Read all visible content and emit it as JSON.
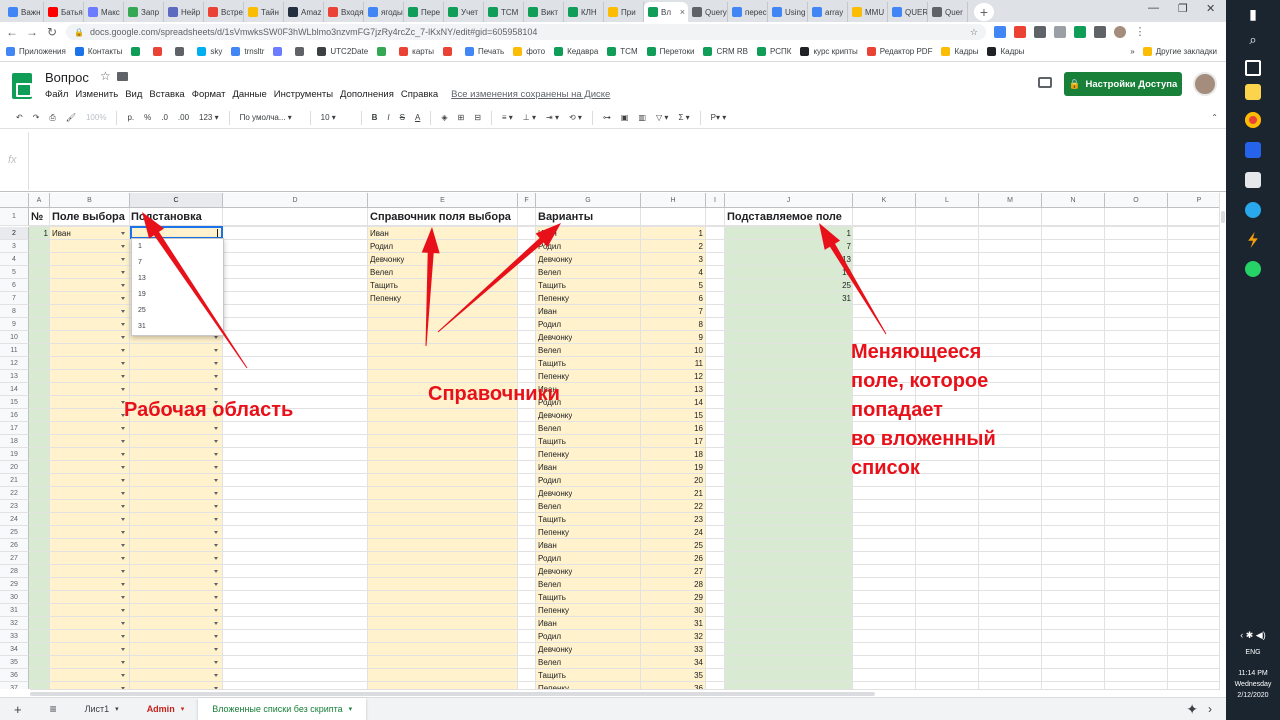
{
  "browser": {
    "tabs": [
      {
        "label": "Важн",
        "color": "#4285f4"
      },
      {
        "label": "Батья",
        "color": "#ff0000"
      },
      {
        "label": "Макс",
        "color": "#6b7cff"
      },
      {
        "label": "Запр",
        "color": "#34a853"
      },
      {
        "label": "Нейр",
        "color": "#5c6bc0"
      },
      {
        "label": "Встре",
        "color": "#ea4335"
      },
      {
        "label": "Тайн",
        "color": "#fbbc04"
      },
      {
        "label": "Amaz",
        "color": "#232f3e"
      },
      {
        "label": "Входя",
        "color": "#ea4335"
      },
      {
        "label": "ягоды",
        "color": "#4285f4"
      },
      {
        "label": "Пере",
        "color": "#0f9d58"
      },
      {
        "label": "Учет",
        "color": "#0f9d58"
      },
      {
        "label": "TCM",
        "color": "#0f9d58"
      },
      {
        "label": "Викт",
        "color": "#0f9d58"
      },
      {
        "label": "КЛН",
        "color": "#0f9d58"
      },
      {
        "label": "При",
        "color": "#fbbc04"
      },
      {
        "label": "Вл",
        "color": "#0f9d58",
        "active": true
      },
      {
        "label": "Query",
        "color": "#5f6368"
      },
      {
        "label": "перес",
        "color": "#4285f4"
      },
      {
        "label": "Using",
        "color": "#4285f4"
      },
      {
        "label": "array",
        "color": "#4285f4"
      },
      {
        "label": "MMU",
        "color": "#fbbc04"
      },
      {
        "label": "QUER",
        "color": "#4285f4"
      },
      {
        "label": "Quer",
        "color": "#5f6368"
      }
    ],
    "new_tab": "+",
    "win_min": "—",
    "win_max": "❐",
    "win_close": "✕",
    "url": "docs.google.com/spreadsheets/d/1sVmwksSW0F3hWLblmo3nzvmFG7jzRy4rcZc_7-lKxNY/edit#gid=605958104",
    "bookmarks": [
      {
        "label": "Приложения",
        "color": "#4285f4"
      },
      {
        "label": "Контакты",
        "color": "#1a73e8"
      },
      {
        "label": "",
        "color": "#0f9d58"
      },
      {
        "label": "",
        "color": "#ea4335"
      },
      {
        "label": "",
        "color": "#5f6368"
      },
      {
        "label": "sky",
        "color": "#00aff0"
      },
      {
        "label": "trnsltr",
        "color": "#4285f4"
      },
      {
        "label": "",
        "color": "#6b7cff"
      },
      {
        "label": "",
        "color": "#5f6368"
      },
      {
        "label": "UTC2Date",
        "color": "#3c4043"
      },
      {
        "label": "",
        "color": "#34a853"
      },
      {
        "label": "карты",
        "color": "#ea4335"
      },
      {
        "label": "",
        "color": "#ea4335"
      },
      {
        "label": "Печать",
        "color": "#4285f4"
      },
      {
        "label": "фото",
        "color": "#fbbc04"
      },
      {
        "label": "Кедавра",
        "color": "#0f9d58"
      },
      {
        "label": "TCM",
        "color": "#0f9d58"
      },
      {
        "label": "Перетоки",
        "color": "#0f9d58"
      },
      {
        "label": "CRM RB",
        "color": "#0f9d58"
      },
      {
        "label": "РСПК",
        "color": "#0f9d58"
      },
      {
        "label": "курс крипты",
        "color": "#202124"
      },
      {
        "label": "Редактор PDF",
        "color": "#ea4335"
      },
      {
        "label": "Кадры",
        "color": "#fbbc04"
      },
      {
        "label": "Кадры",
        "color": "#202124"
      }
    ],
    "bookmarks_more": "»",
    "other_bookmarks": "Другие закладки"
  },
  "sheets": {
    "title": "Вопрос",
    "menu": [
      "Файл",
      "Изменить",
      "Вид",
      "Вставка",
      "Формат",
      "Данные",
      "Инструменты",
      "Дополнения",
      "Справка"
    ],
    "saved_status": "Все изменения сохранены на Диске",
    "share_label": "Настройки Доступа",
    "toolbar": {
      "zoom": "100%",
      "currency": "р.",
      "percent": "%",
      "dec_less": ".0",
      "dec_more": ".00",
      "more_formats": "123 ▾",
      "font": "По умолча... ▾",
      "size": "10 ▾",
      "bold": "B",
      "italic": "I",
      "strike": "S",
      "textcolor": "A",
      "fill_icon": "◈",
      "borders_icon": "⊞",
      "merge_icon": "⊟",
      "align_icon": "≡ ▾",
      "valign_icon": "⊥ ▾",
      "wrap_icon": "⇥ ▾",
      "rotate_icon": "⟲ ▾",
      "link_icon": "⊶",
      "comment_icon": "▣",
      "chart_icon": "▥",
      "filter_icon": "▽ ▾",
      "functions_icon": "Σ ▾",
      "input_tools": "Р▾ ▾",
      "collapse": "⌃"
    },
    "fx_label": "fx",
    "columns": [
      "A",
      "B",
      "C",
      "D",
      "E",
      "F",
      "G",
      "H",
      "I",
      "J",
      "K",
      "L",
      "M",
      "N",
      "O",
      "P"
    ],
    "headers": {
      "num": "№",
      "choice": "Поле выбора",
      "subst": "Подстановка",
      "ref": "Справочник поля выбора",
      "variants": "Варианты",
      "subst_field": "Подставляемое поле"
    },
    "row_a_value": "1",
    "row_b_value": "Иван",
    "reference_list": [
      "Иван",
      "Родил",
      "Девчонку",
      "Велел",
      "Тащить",
      "Пепенку"
    ],
    "variant_names": [
      "Иван",
      "Родил",
      "Девчонку",
      "Велел",
      "Тащить",
      "Пепенку"
    ],
    "variant_count": 36,
    "substituted_values": [
      "1",
      "7",
      "13",
      "19",
      "25",
      "31"
    ],
    "dropdown_options": [
      "1",
      "7",
      "13",
      "19",
      "25",
      "31"
    ],
    "sheet_tabs": [
      {
        "label": "Лист1",
        "active": false,
        "color": "#3c4043"
      },
      {
        "label": "Admin",
        "active": false,
        "color": "#c5221f"
      },
      {
        "label": "Вложенные списки без скрипта",
        "active": true,
        "color": "#188038"
      }
    ],
    "add_sheet": "+",
    "all_sheets": "≡",
    "explore": "✦",
    "collapse_panel": "›"
  },
  "annotations": {
    "workarea": "Рабочая область",
    "refs": "Справочники",
    "changing": [
      "Меняющееся",
      "поле, которое",
      "попадает",
      "во вложенный",
      "список"
    ],
    "color": "#e8111a"
  },
  "taskbar": {
    "lang": "ENG",
    "time": "11:14 PM",
    "day": "Wednesday",
    "date": "2/12/2020"
  }
}
